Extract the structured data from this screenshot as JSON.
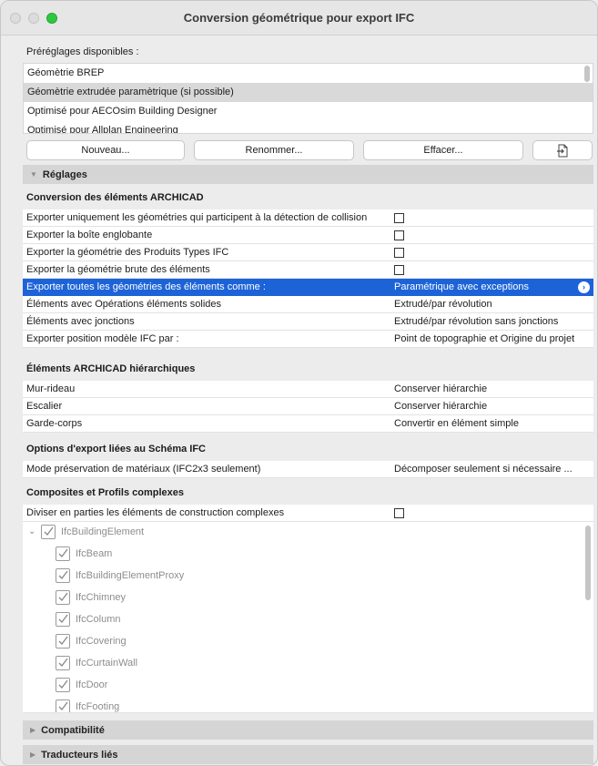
{
  "window": {
    "title": "Conversion géométrique pour export IFC"
  },
  "presets": {
    "label": "Préréglages disponibles :",
    "items": [
      "Géomètrie BREP",
      "Géomètrie extrudée paramètrique (si possible)",
      "Optimisé pour AECOsim Building Designer",
      "Optimisé pour Allplan Engineering"
    ],
    "selected_index": 1
  },
  "buttons": {
    "new": "Nouveau...",
    "rename": "Renommer...",
    "delete": "Effacer...",
    "export_icon": "export-file-icon"
  },
  "settings": {
    "title": "Réglages"
  },
  "conversion": {
    "title": "Conversion des éléments ARCHICAD",
    "rows": [
      {
        "label": "Exporter uniquement les géométries qui participent à la détection de collision",
        "checkbox": true,
        "checked": false,
        "value": ""
      },
      {
        "label": "Exporter la boîte englobante",
        "checkbox": true,
        "checked": false,
        "value": ""
      },
      {
        "label": "Exporter la géométrie des Produits Types IFC",
        "checkbox": true,
        "checked": false,
        "value": ""
      },
      {
        "label": "Exporter la géométrie brute des éléments",
        "checkbox": true,
        "checked": false,
        "value": ""
      },
      {
        "label": "Exporter toutes les géométries des éléments comme :",
        "checkbox": false,
        "value": "Paramétrique avec exceptions",
        "highlighted": true
      },
      {
        "label": "Éléments avec Opérations éléments solides",
        "checkbox": false,
        "value": "Extrudé/par révolution"
      },
      {
        "label": "Éléments avec jonctions",
        "checkbox": false,
        "value": "Extrudé/par révolution sans jonctions"
      },
      {
        "label": "Exporter position modèle IFC par :",
        "checkbox": false,
        "value": "Point de topographie et Origine du projet"
      }
    ]
  },
  "hierarchical": {
    "title": "Éléments ARCHICAD hiérarchiques",
    "rows": [
      {
        "label": "Mur-rideau",
        "value": "Conserver hiérarchie"
      },
      {
        "label": "Escalier",
        "value": "Conserver hiérarchie"
      },
      {
        "label": "Garde-corps",
        "value": "Convertir en élément simple"
      }
    ]
  },
  "schema": {
    "title": "Options d'export liées au Schéma IFC",
    "rows": [
      {
        "label": "Mode préservation de matériaux (IFC2x3 seulement)",
        "value": "Décomposer seulement si nécessaire ..."
      }
    ]
  },
  "composites": {
    "title": "Composites et Profils complexes",
    "split_label": "Diviser en parties les éléments de construction complexes",
    "split_checked": false,
    "tree_root": "IfcBuildingElement",
    "tree_children": [
      "IfcBeam",
      "IfcBuildingElementProxy",
      "IfcChimney",
      "IfcColumn",
      "IfcCovering",
      "IfcCurtainWall",
      "IfcDoor",
      "IfcFooting"
    ]
  },
  "collapsed_sections": {
    "compat": "Compatibilité",
    "translators": "Traducteurs liés"
  },
  "colors": {
    "selection_blue": "#1d63d8",
    "section_gray": "#d5d5d5",
    "green_button": "#2ec840"
  }
}
